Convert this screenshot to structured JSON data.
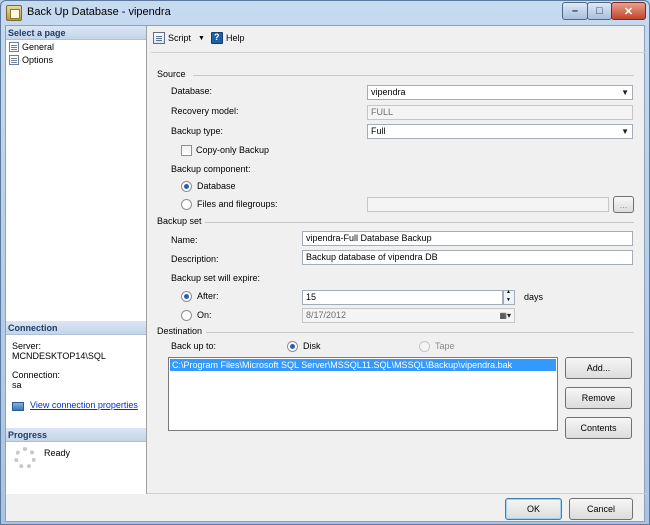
{
  "window": {
    "title": "Back Up Database - vipendra"
  },
  "left_pane": {
    "select_page_header": "Select a page",
    "pages": [
      {
        "label": "General"
      },
      {
        "label": "Options"
      }
    ],
    "connection_header": "Connection",
    "server_label": "Server:",
    "server_value": "MCNDESKTOP14\\SQL",
    "connection_label": "Connection:",
    "connection_value": "sa",
    "view_connection_link": "View connection properties",
    "progress_header": "Progress",
    "progress_status": "Ready"
  },
  "toolbar": {
    "script_label": "Script",
    "help_label": "Help"
  },
  "source": {
    "section_label": "Source",
    "database_label": "Database:",
    "database_value": "vipendra",
    "recovery_model_label": "Recovery model:",
    "recovery_model_value": "FULL",
    "backup_type_label": "Backup type:",
    "backup_type_value": "Full",
    "copy_only_label": "Copy-only Backup",
    "copy_only_checked": false,
    "backup_component_label": "Backup component:",
    "component_database_label": "Database",
    "component_files_label": "Files and filegroups:",
    "component_selected": "database",
    "browse_label": "..."
  },
  "backup_set": {
    "section_label": "Backup set",
    "name_label": "Name:",
    "name_value": "vipendra-Full Database Backup",
    "description_label": "Description:",
    "description_value": "Backup database of vipendra DB",
    "expire_label": "Backup set will expire:",
    "after_label": "After:",
    "after_value": "15",
    "days_label": "days",
    "on_label": "On:",
    "on_value": "8/17/2012",
    "expire_selected": "after"
  },
  "destination": {
    "section_label": "Destination",
    "back_up_to_label": "Back up to:",
    "disk_label": "Disk",
    "tape_label": "Tape",
    "selected": "disk",
    "items": [
      "C:\\Program Files\\Microsoft SQL Server\\MSSQL11.SQL\\MSSQL\\Backup\\vipendra.bak"
    ],
    "add_label": "Add...",
    "remove_label": "Remove",
    "contents_label": "Contents"
  },
  "footer": {
    "ok_label": "OK",
    "cancel_label": "Cancel"
  }
}
